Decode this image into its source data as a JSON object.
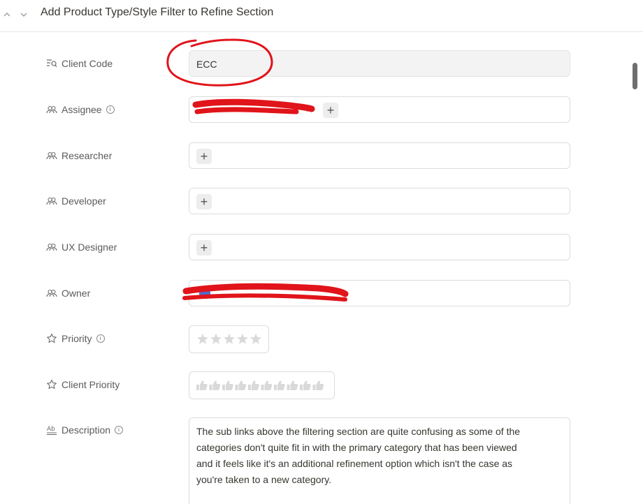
{
  "header": {
    "title": "Add Product Type/Style Filter to Refine Section",
    "nav_up_icon": "chevron-up-icon",
    "nav_down_icon": "chevron-down-icon"
  },
  "properties": {
    "client_code": {
      "label": "Client Code",
      "value": "ECC",
      "icon": "text-search-icon"
    },
    "assignee": {
      "label": "Assignee",
      "icon": "people-icon",
      "has_info": true
    },
    "researcher": {
      "label": "Researcher",
      "icon": "people-icon"
    },
    "developer": {
      "label": "Developer",
      "icon": "people-icon"
    },
    "ux_designer": {
      "label": "UX Designer",
      "icon": "people-icon"
    },
    "owner": {
      "label": "Owner",
      "icon": "people-icon"
    },
    "priority": {
      "label": "Priority",
      "icon": "star-icon",
      "has_info": true,
      "max_stars": 5,
      "rating": 0
    },
    "client_priority": {
      "label": "Client Priority",
      "icon": "star-icon",
      "max_thumbs": 10,
      "rating": 0
    },
    "description": {
      "label": "Description",
      "icon": "text-format-icon",
      "has_info": true,
      "lines": [
        "The sub links above the filtering section are quite confusing as some of the",
        "categories don't quite fit in with the primary category that has been viewed",
        "and it feels like it's an additional refinement option which isn't the case as",
        "you're taken to a new category."
      ]
    }
  },
  "info_glyph": "i",
  "plus_glyph": "+",
  "remove_glyph": "×",
  "colors": {
    "annotation_red": "#e0141a",
    "accent_blue": "#4a6cd4",
    "text": "#37352f",
    "label": "#5a5a5a"
  }
}
